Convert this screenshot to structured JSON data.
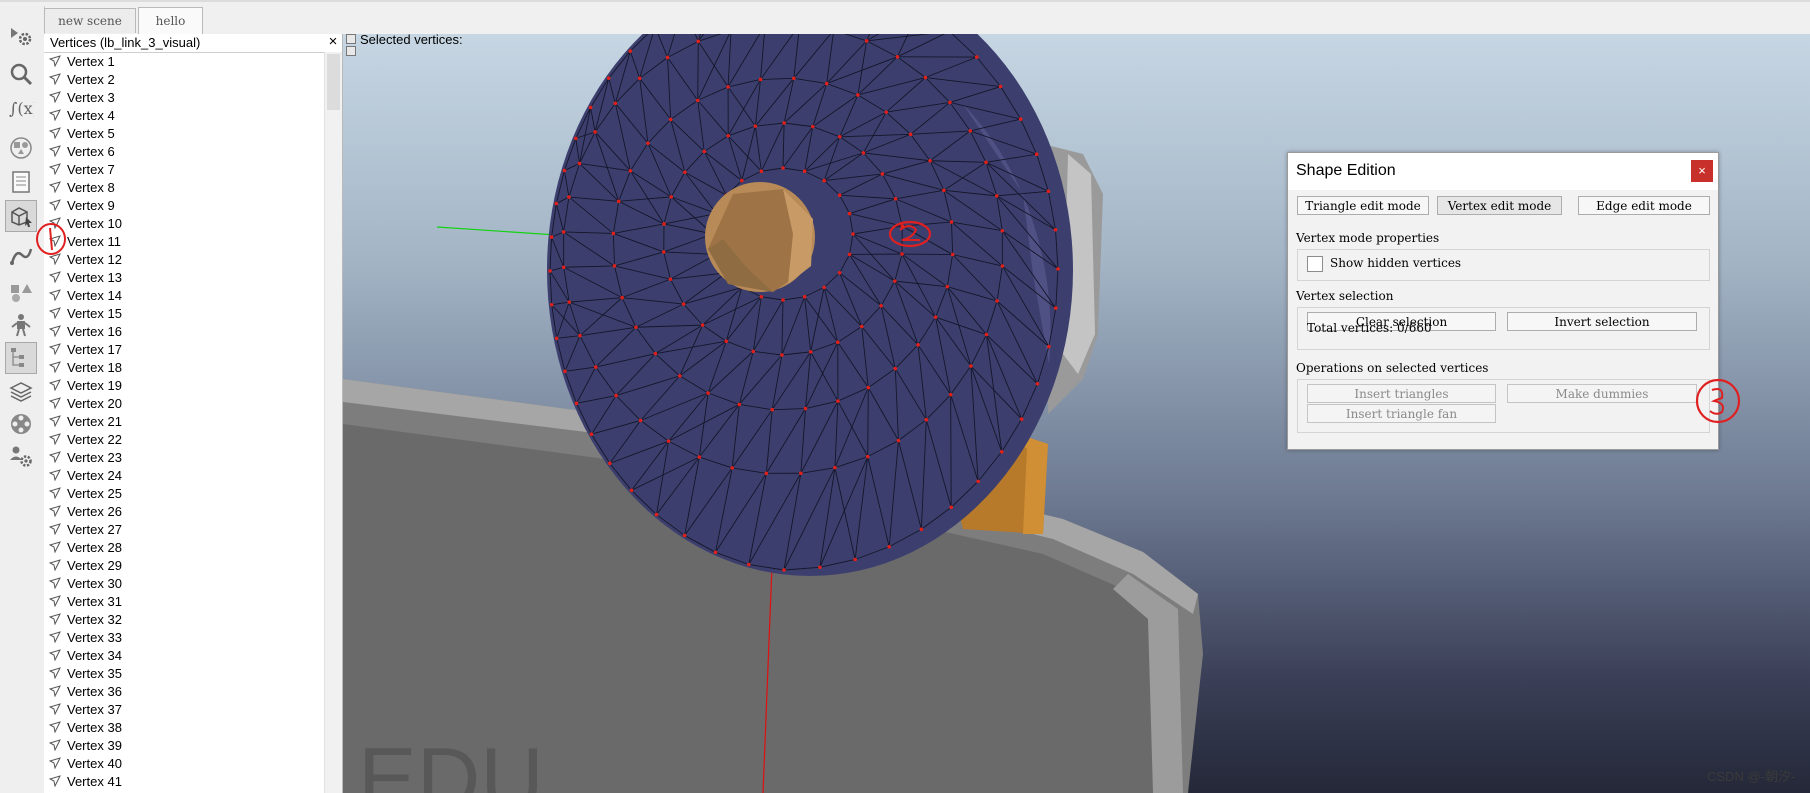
{
  "tabs": [
    {
      "label": "new scene"
    },
    {
      "label": "hello"
    }
  ],
  "toolbar": {
    "tools": [
      {
        "name": "simulation-settings-icon"
      },
      {
        "name": "view-icon"
      },
      {
        "name": "scripts-icon"
      },
      {
        "name": "scene-objects-icon"
      },
      {
        "name": "page-icon"
      },
      {
        "name": "shape-edit-icon"
      },
      {
        "name": "path-edit-icon"
      },
      {
        "name": "model-browser-icon"
      },
      {
        "name": "robot-icon"
      },
      {
        "name": "hierarchy-icon"
      },
      {
        "name": "layers-icon"
      },
      {
        "name": "video-recorder-icon"
      },
      {
        "name": "user-settings-icon"
      }
    ]
  },
  "vertices_panel": {
    "title": "Vertices (lb_link_3_visual)",
    "close_glyph": "×",
    "items": [
      "Vertex 1",
      "Vertex 2",
      "Vertex 3",
      "Vertex 4",
      "Vertex 5",
      "Vertex 6",
      "Vertex 7",
      "Vertex 8",
      "Vertex 9",
      "Vertex 10",
      "Vertex 11",
      "Vertex 12",
      "Vertex 13",
      "Vertex 14",
      "Vertex 15",
      "Vertex 16",
      "Vertex 17",
      "Vertex 18",
      "Vertex 19",
      "Vertex 20",
      "Vertex 21",
      "Vertex 22",
      "Vertex 23",
      "Vertex 24",
      "Vertex 25",
      "Vertex 26",
      "Vertex 27",
      "Vertex 28",
      "Vertex 29",
      "Vertex 30",
      "Vertex 31",
      "Vertex 32",
      "Vertex 33",
      "Vertex 34",
      "Vertex 35",
      "Vertex 36",
      "Vertex 37",
      "Vertex 38",
      "Vertex 39",
      "Vertex 40",
      "Vertex 41"
    ]
  },
  "viewport": {
    "selected_label": "Selected vertices:",
    "watermark": "CSDN @-朝汐-"
  },
  "dialog": {
    "title": "Shape Edition",
    "close_glyph": "×",
    "modes": {
      "triangle": "Triangle edit mode",
      "vertex": "Vertex edit mode",
      "edge": "Edge edit mode"
    },
    "vertex_mode_properties": {
      "heading": "Vertex mode properties",
      "show_hidden_label": "Show hidden vertices",
      "show_hidden_checked": false
    },
    "vertex_selection": {
      "heading": "Vertex selection",
      "clear_label": "Clear selection",
      "invert_label": "Invert selection",
      "total_text": "Total vertices: 0/660"
    },
    "operations": {
      "heading": "Operations on selected vertices",
      "insert_triangles_label": "Insert triangles",
      "make_dummies_label": "Make dummies",
      "insert_fan_label": "Insert triangle fan"
    }
  },
  "colors": {
    "mesh_fill": "#3c3f6e",
    "vertex_dot": "#e0201a",
    "dialog_close": "#c8302c",
    "annotation": "#e02020"
  }
}
